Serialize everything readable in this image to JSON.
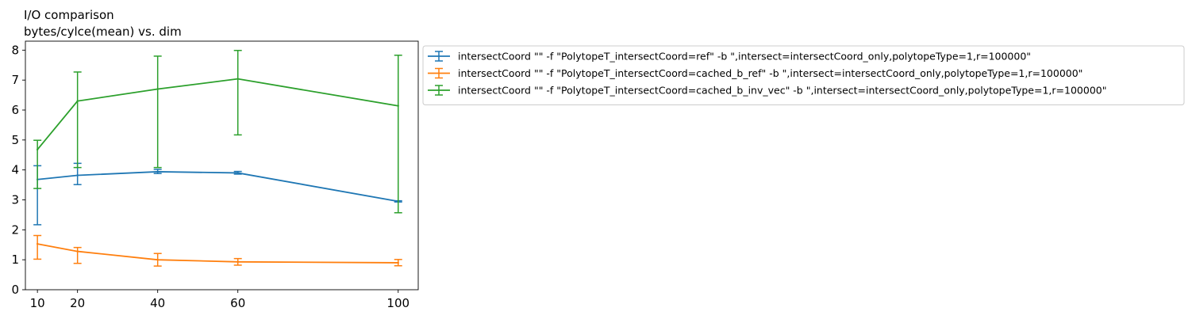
{
  "chart_data": {
    "type": "line",
    "title": "I/O comparison",
    "subtitle": "bytes/cylce(mean) vs. dim",
    "xlabel": "",
    "ylabel": "",
    "x": [
      10,
      20,
      40,
      60,
      100
    ],
    "xlim": [
      7,
      105
    ],
    "ylim": [
      0,
      8.3
    ],
    "xticks": [
      10,
      20,
      40,
      60,
      100
    ],
    "yticks": [
      0,
      1,
      2,
      3,
      4,
      5,
      6,
      7,
      8
    ],
    "grid": false,
    "legend_position": "outside-right",
    "series": [
      {
        "name": "intersectCoord \"\" -f \"PolytopeT_intersectCoord=ref\" -b \",intersect=intersectCoord_only,polytopeType=1,r=100000\"",
        "color": "#1f77b4",
        "values": [
          3.68,
          3.82,
          3.94,
          3.9,
          2.95
        ],
        "err_low": [
          2.17,
          3.51,
          3.88,
          3.86,
          2.93
        ],
        "err_high": [
          4.14,
          4.22,
          4.02,
          3.95,
          2.97
        ]
      },
      {
        "name": "intersectCoord \"\" -f \"PolytopeT_intersectCoord=cached_b_ref\" -b \",intersect=intersectCoord_only,polytopeType=1,r=100000\"",
        "color": "#ff7f0e",
        "values": [
          1.53,
          1.28,
          1.0,
          0.93,
          0.9
        ],
        "err_low": [
          1.02,
          0.88,
          0.79,
          0.82,
          0.8
        ],
        "err_high": [
          1.81,
          1.41,
          1.21,
          1.04,
          1.01
        ]
      },
      {
        "name": "intersectCoord \"\" -f \"PolytopeT_intersectCoord=cached_b_inv_vec\" -b \",intersect=intersectCoord_only,polytopeType=1,r=100000\"",
        "color": "#2ca02c",
        "values": [
          4.68,
          6.3,
          6.7,
          7.04,
          6.14
        ],
        "err_low": [
          3.38,
          4.08,
          4.08,
          5.17,
          2.57
        ],
        "err_high": [
          4.99,
          7.27,
          7.8,
          7.99,
          7.83
        ]
      }
    ]
  }
}
